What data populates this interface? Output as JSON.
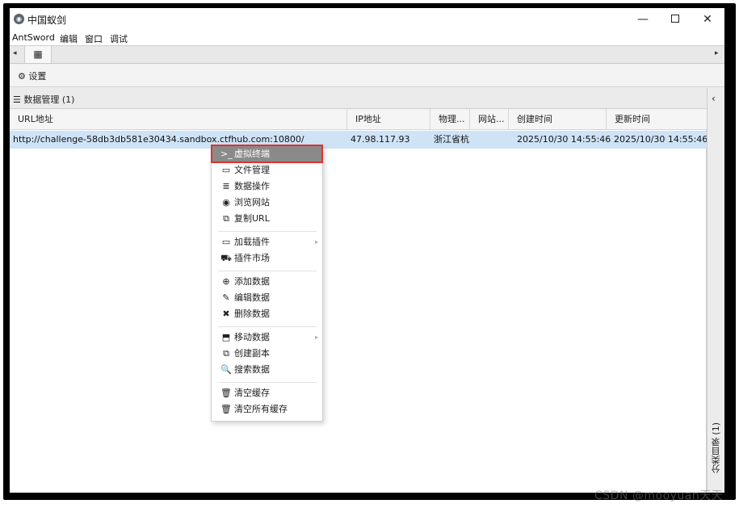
{
  "window": {
    "title": "中国蚁剑",
    "minimize_label": "—",
    "close_label": "✕"
  },
  "menubar": {
    "items": [
      "AntSword",
      "编辑",
      "窗口",
      "调试"
    ]
  },
  "tabbar": {
    "left_arrow": "◂",
    "right_arrow": "▸",
    "home_icon": "▦"
  },
  "toolbar": {
    "settings_label": "设置"
  },
  "panel": {
    "title": "数据管理 (1)"
  },
  "sidebar": {
    "collapse_arrow": "‹",
    "label": "分类目录 (1)"
  },
  "grid": {
    "columns": [
      "URL地址",
      "IP地址",
      "物理...",
      "网站...",
      "创建时间",
      "更新时间"
    ],
    "rows": [
      {
        "url": "http://challenge-58db3db581e30434.sandbox.ctfhub.com:10800/",
        "ip": "47.98.117.93",
        "location": "浙江省杭",
        "site": "",
        "created": "2025/10/30 14:55:46",
        "updated": "2025/10/30 14:55:46"
      }
    ]
  },
  "context_menu": {
    "items": [
      {
        "label": "虚拟终端",
        "icon": "terminal-icon",
        "glyph": ">_"
      },
      {
        "label": "文件管理",
        "icon": "folder-icon",
        "glyph": "▭"
      },
      {
        "label": "数据操作",
        "icon": "database-icon",
        "glyph": "≣"
      },
      {
        "label": "浏览网站",
        "icon": "chrome-icon",
        "glyph": "◉"
      },
      {
        "label": "复制URL",
        "icon": "copy-icon",
        "glyph": "⧉"
      },
      {
        "label": "加载插件",
        "icon": "folder-icon",
        "glyph": "▭"
      },
      {
        "label": "插件市场",
        "icon": "cart-icon",
        "glyph": "⛟"
      },
      {
        "label": "添加数据",
        "icon": "plus-circle-icon",
        "glyph": "⊕"
      },
      {
        "label": "编辑数据",
        "icon": "edit-icon",
        "glyph": "✎"
      },
      {
        "label": "删除数据",
        "icon": "close-icon",
        "glyph": "✖"
      },
      {
        "label": "移动数据",
        "icon": "move-icon",
        "glyph": "⬒"
      },
      {
        "label": "创建副本",
        "icon": "copy-icon",
        "glyph": "⧉"
      },
      {
        "label": "搜索数据",
        "icon": "search-icon",
        "glyph": "🔍"
      },
      {
        "label": "清空缓存",
        "icon": "trash-icon",
        "glyph": "🗑"
      },
      {
        "label": "清空所有缓存",
        "icon": "trash-icon",
        "glyph": "🗑"
      }
    ],
    "submenu_arrow": "▸",
    "highlight_color": "#e0322e"
  },
  "watermark": "CSDN @mooyuan天天"
}
